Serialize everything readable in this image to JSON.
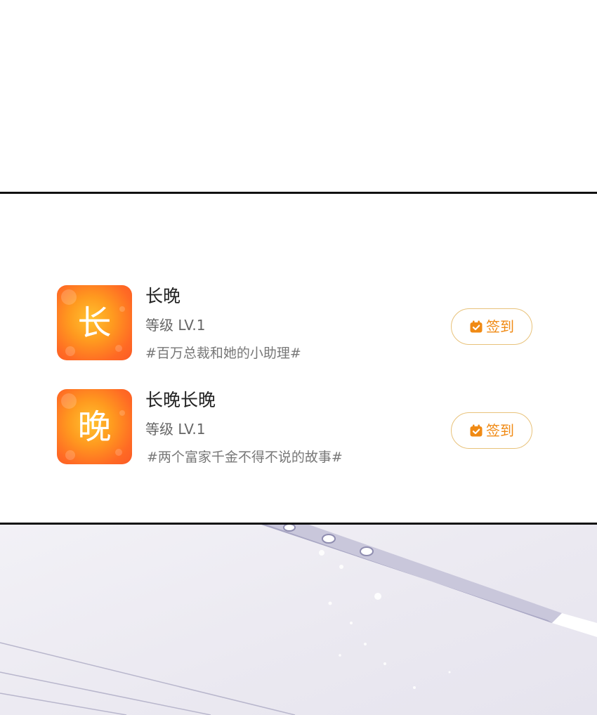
{
  "entries": [
    {
      "icon_char": "长",
      "name": "长晚",
      "level": "等级 LV.1",
      "tag": "#百万总裁和她的小助理#",
      "checkin_label": "签到",
      "icon": "calendar-check-icon"
    },
    {
      "icon_char": "晚",
      "name": "长晚长晚",
      "level": "等级 LV.1",
      "tag": "#两个富家千金不得不说的故事#",
      "checkin_label": "签到",
      "icon": "calendar-check-icon"
    }
  ],
  "colors": {
    "accent": "#f08a14",
    "button_border": "#e8c27a",
    "icon_gradient_start": "#ffc230",
    "icon_gradient_end": "#fb5a26"
  }
}
